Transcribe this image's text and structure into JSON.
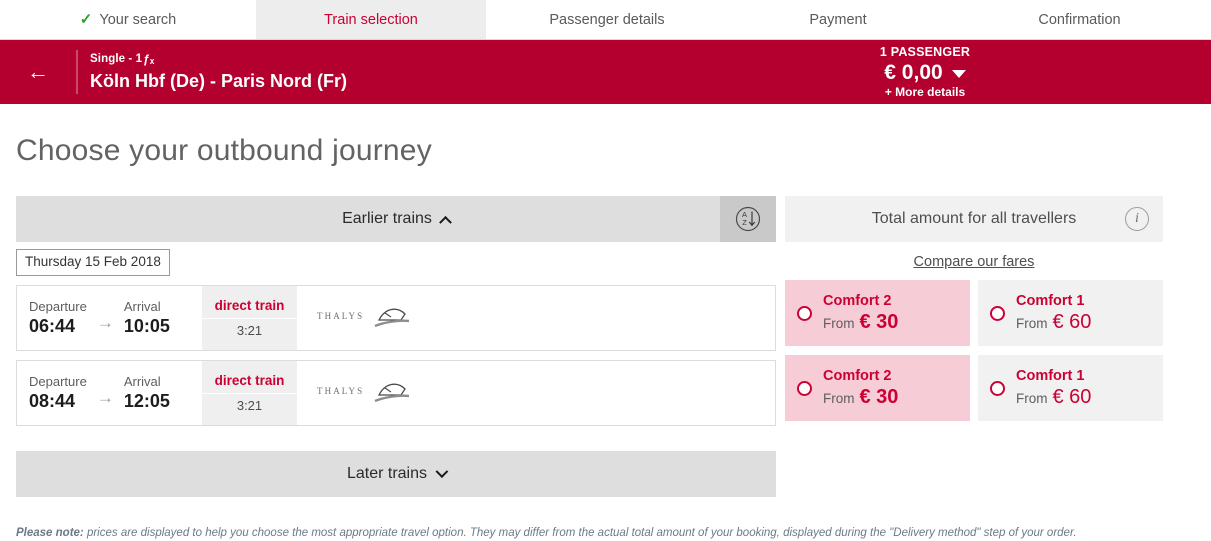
{
  "steps": [
    {
      "label": "Your search",
      "icon": "check-icon",
      "completed": true,
      "active": false
    },
    {
      "label": "Train selection",
      "icon": "",
      "completed": false,
      "active": true
    },
    {
      "label": "Passenger details",
      "icon": "",
      "completed": false,
      "active": false
    },
    {
      "label": "Payment",
      "icon": "",
      "completed": false,
      "active": false
    },
    {
      "label": "Confirmation",
      "icon": "",
      "completed": false,
      "active": false
    }
  ],
  "journey_bar": {
    "back_icon": "arrow-left-icon",
    "back_glyph": "←",
    "trip_type": "Single - 1",
    "passenger_glyph": "ƒₓ",
    "route": "Köln Hbf (De) - Paris Nord (Fr)",
    "basket": {
      "passengers": "1 PASSENGER",
      "amount": "€ 0,00",
      "more_details": "+ More details",
      "caret_icon": "caret-down-icon"
    },
    "background_color": "#b3002f"
  },
  "page_title": "Choose your outbound journey",
  "earlier_trains": {
    "label": "Earlier trains",
    "chevron_icon": "chevron-up-icon",
    "sort_icon": "sort-az-icon"
  },
  "later_trains": {
    "label": "Later trains",
    "chevron_icon": "chevron-down-icon"
  },
  "date_chip": "Thursday 15 Feb 2018",
  "labels": {
    "departure": "Departure",
    "arrival": "Arrival",
    "arrow_glyph": "→",
    "direct_train": "direct train",
    "from": "From",
    "carrier": "THALYS"
  },
  "trains": [
    {
      "departure": "06:44",
      "arrival": "10:05",
      "type": "direct train",
      "duration": "3:21",
      "carrier": "THALYS"
    },
    {
      "departure": "08:44",
      "arrival": "12:05",
      "type": "direct train",
      "duration": "3:21",
      "carrier": "THALYS"
    }
  ],
  "fares_panel": {
    "total_label": "Total amount for all travellers",
    "info_icon": "info-icon",
    "info_glyph": "i",
    "compare_link": "Compare our fares"
  },
  "fare_rows": [
    [
      {
        "name": "Comfort 2",
        "from": "From",
        "price": "€ 30",
        "style": "pink",
        "selected": false
      },
      {
        "name": "Comfort 1",
        "from": "From",
        "price": "€ 60",
        "style": "grey",
        "selected": false
      }
    ],
    [
      {
        "name": "Comfort 2",
        "from": "From",
        "price": "€ 30",
        "style": "pink",
        "selected": false
      },
      {
        "name": "Comfort 1",
        "from": "From",
        "price": "€ 60",
        "style": "grey",
        "selected": false
      }
    ]
  ],
  "footer": {
    "prefix": "Please note:",
    "text": " prices are displayed to help you choose the most appropriate travel option. They may differ from the actual total amount of your booking, displayed during the \"Delivery method\" step of your order."
  },
  "colors": {
    "brand_red": "#b3002f",
    "accent_red": "#cc0033",
    "fare_pink": "#f6cdd6",
    "bar_grey": "#dedede",
    "panel_grey": "#f1f1f1",
    "check_green": "#2aa12a"
  }
}
